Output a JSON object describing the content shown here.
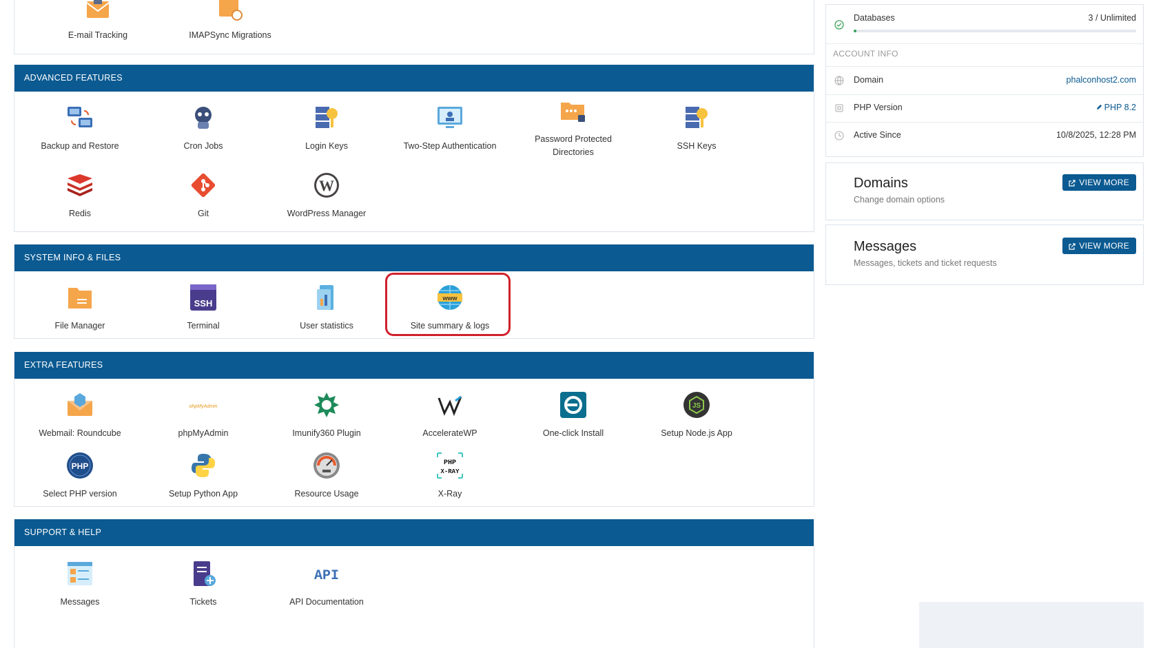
{
  "colors": {
    "header": "#0b5a91",
    "highlight": "#d0202c",
    "link": "#0b5a91"
  },
  "top_partial": {
    "items": [
      {
        "label": "E-mail Tracking",
        "icon": "email-tracking-icon"
      },
      {
        "label": "IMAPSync Migrations",
        "icon": "imapsync-icon"
      }
    ]
  },
  "advanced": {
    "title": "ADVANCED FEATURES",
    "items": [
      {
        "label": "Backup and Restore",
        "icon": "backup-icon"
      },
      {
        "label": "Cron Jobs",
        "icon": "cron-icon"
      },
      {
        "label": "Login Keys",
        "icon": "login-keys-icon"
      },
      {
        "label": "Two-Step Authentication",
        "icon": "two-step-icon"
      },
      {
        "label": "Password Protected Directories",
        "icon": "password-dir-icon"
      },
      {
        "label": "SSH Keys",
        "icon": "ssh-keys-icon"
      },
      {
        "label": "Redis",
        "icon": "redis-icon"
      },
      {
        "label": "Git",
        "icon": "git-icon"
      },
      {
        "label": "WordPress Manager",
        "icon": "wordpress-icon"
      }
    ]
  },
  "system": {
    "title": "SYSTEM INFO & FILES",
    "items": [
      {
        "label": "File Manager",
        "icon": "file-manager-icon"
      },
      {
        "label": "Terminal",
        "icon": "terminal-icon",
        "icon_text": "SSH"
      },
      {
        "label": "User statistics",
        "icon": "statistics-icon"
      },
      {
        "label": "Site summary & logs",
        "icon": "www-globe-icon",
        "icon_text": "www"
      }
    ]
  },
  "extra": {
    "title": "EXTRA FEATURES",
    "items": [
      {
        "label": "Webmail: Roundcube",
        "icon": "roundcube-icon"
      },
      {
        "label": "phpMyAdmin",
        "icon": "phpmyadmin-icon",
        "icon_text": "phpMyAdmin"
      },
      {
        "label": "Imunify360 Plugin",
        "icon": "imunify-icon"
      },
      {
        "label": "AccelerateWP",
        "icon": "acceleratewp-icon"
      },
      {
        "label": "One-click Install",
        "icon": "one-click-icon"
      },
      {
        "label": "Setup Node.js App",
        "icon": "nodejs-icon",
        "icon_text": "JS"
      },
      {
        "label": "Select PHP version",
        "icon": "php-icon",
        "icon_text": "PHP"
      },
      {
        "label": "Setup Python App",
        "icon": "python-icon"
      },
      {
        "label": "Resource Usage",
        "icon": "gauge-icon"
      },
      {
        "label": "X-Ray",
        "icon": "xray-icon",
        "icon_text": "PHP X-RAY"
      }
    ]
  },
  "support": {
    "title": "SUPPORT & HELP",
    "items": [
      {
        "label": "Messages",
        "icon": "messages-icon"
      },
      {
        "label": "Tickets",
        "icon": "tickets-icon"
      },
      {
        "label": "API Documentation",
        "icon": "api-icon",
        "icon_text": "API"
      }
    ]
  },
  "sidebar": {
    "databases": {
      "label": "Databases",
      "value": "3 / Unlimited",
      "usage_fraction": 0.01
    },
    "account_info_title": "ACCOUNT INFO",
    "domain": {
      "label": "Domain",
      "value": "phalconhost2.com"
    },
    "php": {
      "label": "PHP Version",
      "value": "PHP 8.2"
    },
    "active": {
      "label": "Active Since",
      "value": "10/8/2025, 12:28 PM"
    },
    "domains_card": {
      "title": "Domains",
      "subtitle": "Change domain options",
      "button": "VIEW MORE"
    },
    "messages_card": {
      "title": "Messages",
      "subtitle": "Messages, tickets and ticket requests",
      "button": "VIEW MORE"
    }
  }
}
